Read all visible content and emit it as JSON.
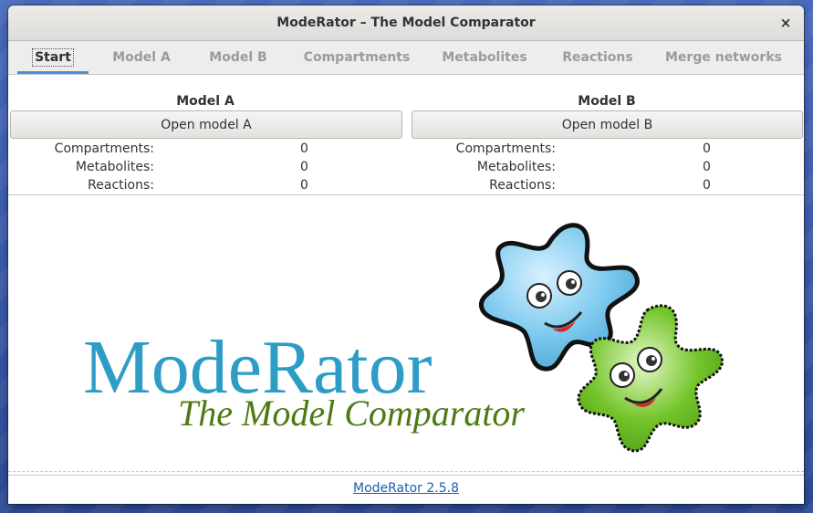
{
  "window": {
    "title": "ModeRator – The Model Comparator",
    "close_glyph": "×"
  },
  "tabs": [
    {
      "label": "Start",
      "active": true
    },
    {
      "label": "Model A",
      "active": false
    },
    {
      "label": "Model B",
      "active": false
    },
    {
      "label": "Compartments",
      "active": false
    },
    {
      "label": "Metabolites",
      "active": false
    },
    {
      "label": "Reactions",
      "active": false
    },
    {
      "label": "Merge networks",
      "active": false
    }
  ],
  "model_a": {
    "heading": "Model A",
    "open_label": "Open model A",
    "stats": [
      {
        "label": "Compartments:",
        "value": "0"
      },
      {
        "label": "Metabolites:",
        "value": "0"
      },
      {
        "label": "Reactions:",
        "value": "0"
      }
    ]
  },
  "model_b": {
    "heading": "Model B",
    "open_label": "Open model B",
    "stats": [
      {
        "label": "Compartments:",
        "value": "0"
      },
      {
        "label": "Metabolites:",
        "value": "0"
      },
      {
        "label": "Reactions:",
        "value": "0"
      }
    ]
  },
  "logo": {
    "name": "ModeRator",
    "tagline": "The Model Comparator",
    "name_color": "#2e9dc6",
    "tagline_color": "#4e7a12",
    "blue_creature_color": "#7cc9ee",
    "green_creature_color": "#74c52b"
  },
  "footer": {
    "version_link": "ModeRator 2.5.8",
    "link_color": "#1a5fb4"
  }
}
